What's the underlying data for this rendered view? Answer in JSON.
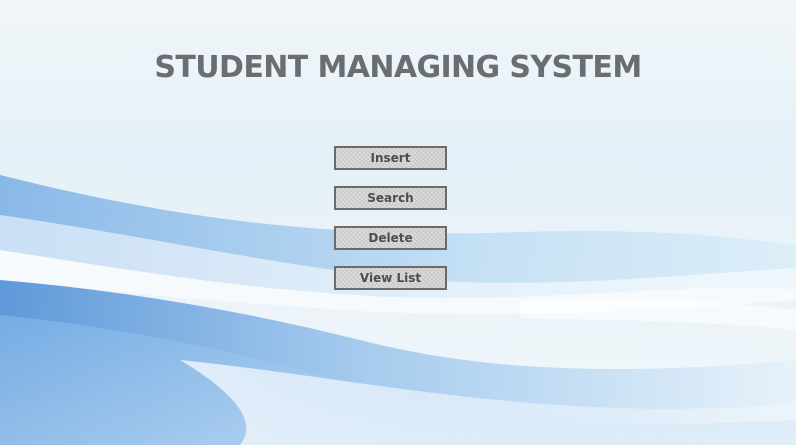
{
  "page": {
    "title": "STUDENT MANAGING SYSTEM"
  },
  "menu": {
    "buttons": [
      {
        "label": "Insert"
      },
      {
        "label": "Search"
      },
      {
        "label": "Delete"
      },
      {
        "label": "View List"
      }
    ]
  },
  "colors": {
    "title_text": "#6a6e72",
    "button_face": "#d0d0d0",
    "button_border": "#6b6b6b",
    "button_text": "#4e4e4e",
    "background_light": "#e9f3f9",
    "background_wave_blue": "#5d9bdc"
  }
}
